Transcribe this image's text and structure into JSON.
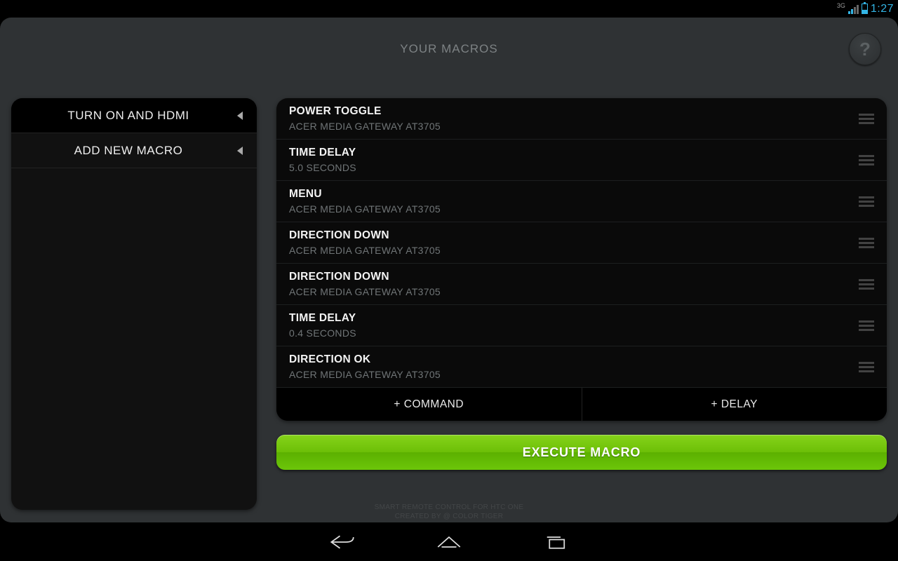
{
  "status": {
    "network": "3G",
    "clock": "1:27"
  },
  "header": {
    "title": "YOUR MACROS"
  },
  "sidebar": {
    "items": [
      {
        "label": "TURN ON AND HDMI",
        "selected": true
      },
      {
        "label": "ADD NEW MACRO",
        "selected": false
      }
    ]
  },
  "commands": [
    {
      "title": "POWER TOGGLE",
      "sub": "ACER MEDIA GATEWAY AT3705"
    },
    {
      "title": "TIME DELAY",
      "sub": "5.0 SECONDS"
    },
    {
      "title": "MENU",
      "sub": "ACER MEDIA GATEWAY AT3705"
    },
    {
      "title": "DIRECTION DOWN",
      "sub": "ACER MEDIA GATEWAY AT3705"
    },
    {
      "title": "DIRECTION DOWN",
      "sub": "ACER MEDIA GATEWAY AT3705"
    },
    {
      "title": "TIME DELAY",
      "sub": "0.4 SECONDS"
    },
    {
      "title": "DIRECTION OK",
      "sub": "ACER MEDIA GATEWAY AT3705"
    }
  ],
  "actions": {
    "add_command": "+ COMMAND",
    "add_delay": "+ DELAY",
    "execute": "EXECUTE MACRO"
  },
  "footer": {
    "line1": "SMART REMOTE CONTROL FOR HTC ONE",
    "line2": "CREATED BY @ COLOR TIGER"
  }
}
